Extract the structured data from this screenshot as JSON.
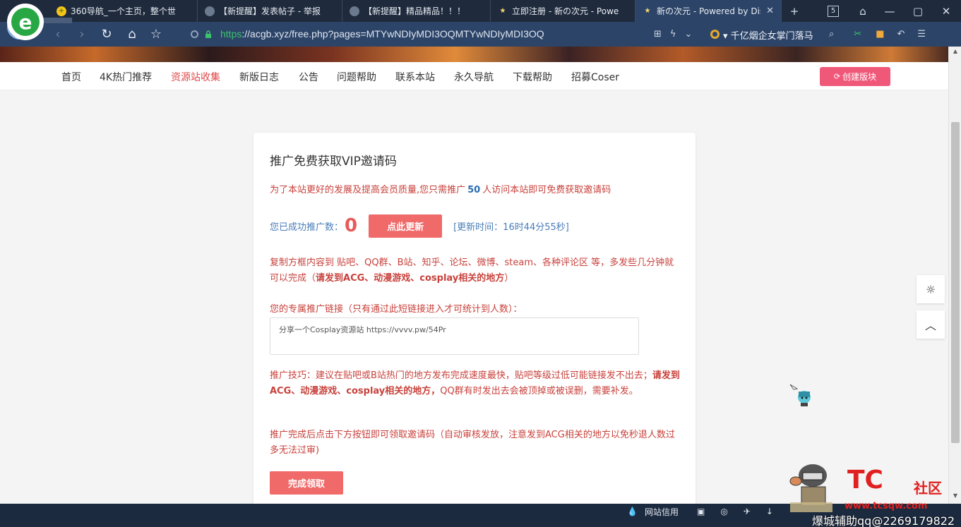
{
  "browser": {
    "tabs": [
      {
        "title": "360导航_一个主页，整个世",
        "icon": "360-icon",
        "active": false
      },
      {
        "title": "【新提醒】发表帖子 - 举报",
        "icon": "avatar-icon",
        "active": false
      },
      {
        "title": "【新提醒】精品精品！！！",
        "icon": "avatar-icon",
        "active": false
      },
      {
        "title": "立即注册 - 新の次元 - Powe",
        "icon": "star-icon",
        "active": false
      },
      {
        "title": "新の次元 - Powered by Dis",
        "icon": "star-icon",
        "active": true
      }
    ],
    "tab_count": "5",
    "url_scheme": "https",
    "url_rest": "://acgb.xyz/free.php?pages=MTYwNDIyMDI3OQMTYwNDIyMDI3OQ",
    "news_ticker": "千亿烟企女掌门落马"
  },
  "site": {
    "nav": [
      {
        "label": "首页",
        "active": false
      },
      {
        "label": "4K热门推荐",
        "active": false
      },
      {
        "label": "资源站收集",
        "active": true
      },
      {
        "label": "新版日志",
        "active": false
      },
      {
        "label": "公告",
        "active": false
      },
      {
        "label": "问题帮助",
        "active": false
      },
      {
        "label": "联系本站",
        "active": false
      },
      {
        "label": "永久导航",
        "active": false
      },
      {
        "label": "下载帮助",
        "active": false
      },
      {
        "label": "招募Coser",
        "active": false
      }
    ],
    "create_button": "创建版块"
  },
  "card": {
    "title": "推广免费获取VIP邀请码",
    "intro_before": "为了本站更好的发展及提高会员质量,您只需推广",
    "intro_num": "50",
    "intro_after": "人访问本站即可免费获取邀请码",
    "count_label": "您已成功推广数：",
    "count_value": "0",
    "refresh_button": "点此更新",
    "update_time": "[更新时间：16时44分55秒]",
    "copy_text_1": "复制方框内容到 贴吧、QQ群、B站、知乎、论坛、微博、steam、各种评论区 等，多发些几分钟就可以完成（",
    "copy_bold": "请发到ACG、动漫游戏、cosplay相关的地方",
    "copy_text_2": "）",
    "link_label": "您的专属推广链接（只有通过此短链接进入才可统计到人数）：",
    "link_value": "分享一个Cosplay资源站 https://vvvv.pw/54Pr",
    "tip_text_1": "推广技巧：建议在贴吧或B站热门的地方发布完成速度最快，贴吧等级过低可能链接发不出去；",
    "tip_bold": "请发到ACG、动漫游戏、cosplay相关的地方，",
    "tip_text_2": "QQ群有时发出去会被顶掉或被误删，需要补发。",
    "finish_text": "推广完成后点击下方按钮即可领取邀请码（自动审核发放，注意发到ACG相关的地方以免秒退人数过多无法过审)",
    "done_button": "完成领取"
  },
  "taskbar": {
    "tray_text": "网站信用"
  },
  "watermark": {
    "logo": "TC",
    "community": "社区",
    "url": "www.tcsqw.com",
    "qq": "爆城辅助qq@2269179822"
  },
  "colors": {
    "accent_red": "#e04848",
    "button_red": "#f06a6a",
    "pink": "#f0587a",
    "blue_text": "#4a7db8",
    "browser_dark": "#1f2b3d"
  }
}
